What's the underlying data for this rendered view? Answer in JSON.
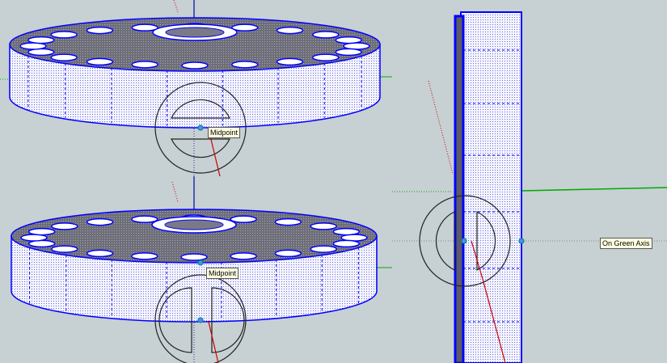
{
  "viewport": {
    "background": "#c7d0d3",
    "face_color": "#ffffff",
    "edge_color": "#0000ff",
    "inference_tooltips": [
      {
        "id": "top",
        "text": "Midpoint"
      },
      {
        "id": "bottom",
        "text": "Midpoint"
      },
      {
        "id": "right",
        "text": "On Green Axis"
      }
    ],
    "axis_colors": {
      "red": "#cc0000",
      "green": "#00aa00",
      "blue": "#0000cc"
    }
  }
}
